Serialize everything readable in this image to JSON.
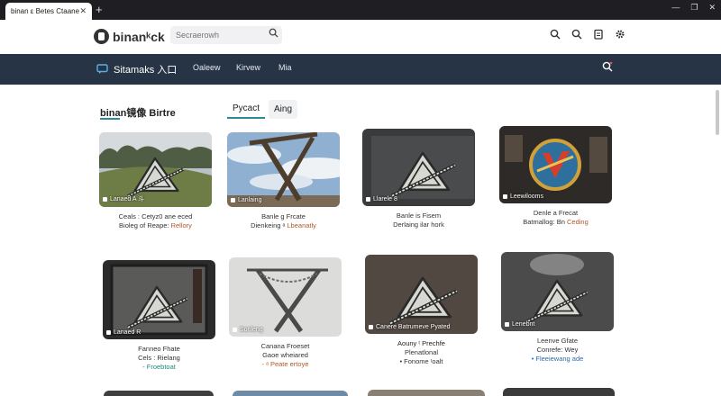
{
  "browser": {
    "tab_title": "binan ε Betes Ctaaneteid",
    "close_glyph": "✕",
    "new_tab_glyph": "+",
    "window_controls": [
      "—",
      "❐",
      "✕"
    ]
  },
  "header": {
    "logo_text": "binanᵏck",
    "search_placeholder": "Secraerowh",
    "icons": [
      "search-icon",
      "search-alt-icon",
      "clipboard-icon",
      "gear-icon"
    ]
  },
  "navbar": {
    "home_label": "Sitamaks 入口",
    "links": [
      "Oaleew",
      "Kirvew",
      "Mia"
    ],
    "search_icon": "search-icon"
  },
  "section": {
    "title": "binan镜像 Birtre",
    "tabs": [
      {
        "label": "Pycact",
        "active": true
      },
      {
        "label": "Aing",
        "active": false
      }
    ]
  },
  "cards": [
    {
      "badge": "Lanaed A 斗",
      "line1": "Ceals : Cetyz0 ane eced",
      "line2_prefix": "Bioleg of Reape: ",
      "line2_accent": "Rellory",
      "scene": "landscape"
    },
    {
      "badge": "Lanlaing",
      "line1": "Banle g Frcate",
      "line2_prefix": "Dienkeing ᵃ ",
      "line2_accent": "Lbeanatly",
      "scene": "sky-x"
    },
    {
      "badge": "Llarele 8",
      "line1": "Banle is Fisem",
      "line2_prefix": "Derlaing ilar hork",
      "line2_accent": "",
      "scene": "dark"
    },
    {
      "badge": "Leewilooms",
      "line1": "Denle a Frecat",
      "line2_prefix": "Batmallog: Bn ",
      "line2_accent": "Ceding",
      "scene": "colorful"
    },
    {
      "badge": "Lanaed R",
      "line1": "Fanneo Fhate",
      "line2": "Cels : Rielang",
      "line3": "- Froebtoat",
      "scene": "monitor"
    },
    {
      "badge": "Sonleng",
      "line1": "Canana Froeset",
      "line2": "Gaoe wheiared",
      "line3": "- ᵃ Peate ertoye",
      "scene": "pale-x"
    },
    {
      "badge": "Canere Batrumeve Pyated",
      "line1": "Aouny ᵗ Prechfe",
      "line2": "Plenatlonal",
      "line3": "• Fonome ᵗoalt",
      "scene": "brown"
    },
    {
      "badge": "Lenebnt",
      "line1": "Leenve Gfate",
      "line2": "Conrefe: Wey",
      "line3": "• Fleeiewang ade",
      "scene": "bw"
    }
  ]
}
